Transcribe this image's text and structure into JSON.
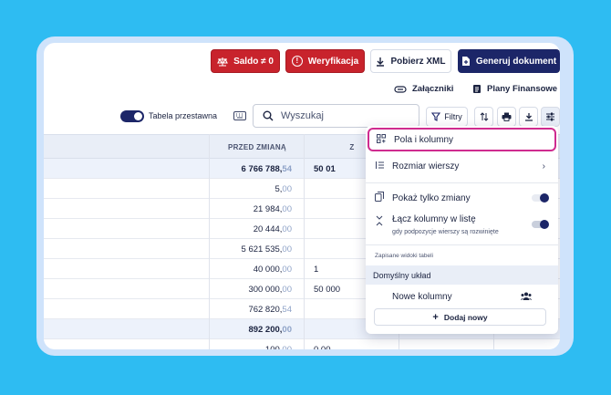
{
  "header": {
    "saldo_label": "Saldo ≠ 0",
    "verification_label": "Weryfikacja",
    "download_xml_label": "Pobierz XML",
    "generate_label": "Generuj dokument",
    "attachments_label": "Załączniki",
    "plans_label": "Plany Finansowe"
  },
  "toolbar": {
    "pivot_label": "Tabela przestawna",
    "search_placeholder": "Wyszukaj",
    "filters_label": "Filtry"
  },
  "table": {
    "col_before": "PRZED ZMIANĄ",
    "col_second_partial": "Z",
    "rows": [
      {
        "before_int": "6 766 788,",
        "before_dec": "54",
        "second": "50 01",
        "highlight": true
      },
      {
        "before_int": "5,",
        "before_dec": "00",
        "second": "",
        "highlight": false
      },
      {
        "before_int": "21 984,",
        "before_dec": "00",
        "second": "",
        "highlight": false
      },
      {
        "before_int": "20 444,",
        "before_dec": "00",
        "second": "",
        "highlight": false
      },
      {
        "before_int": "5 621 535,",
        "before_dec": "00",
        "second": "",
        "highlight": false
      },
      {
        "before_int": "40 000,",
        "before_dec": "00",
        "second": "1",
        "highlight": false
      },
      {
        "before_int": "300 000,",
        "before_dec": "00",
        "second": "50 000",
        "highlight": false
      },
      {
        "before_int": "762 820,",
        "before_dec": "54",
        "second": "",
        "highlight": false
      },
      {
        "before_int": "892 200,",
        "before_dec": "00",
        "second": "",
        "highlight": true
      },
      {
        "before_int": "100,",
        "before_dec": "00",
        "second": "0,00",
        "highlight": false
      }
    ]
  },
  "menu": {
    "fields_label": "Pola i kolumny",
    "row_size_label": "Rozmiar wierszy",
    "show_changes_label": "Pokaż tylko zmiany",
    "merge_label": "Łącz kolumny w listę",
    "merge_sub": "gdy podpozycje wierszy są rozwinięte",
    "saved_header": "Zapisane widoki tabeli",
    "default_view": "Domyślny układ",
    "new_columns": "Nowe kolumny",
    "add_new": "Dodaj nowy"
  },
  "colors": {
    "brand_dark": "#1c2668",
    "danger": "#c8232c",
    "highlight_border": "#cf2b8f",
    "background": "#2ebcf2"
  }
}
